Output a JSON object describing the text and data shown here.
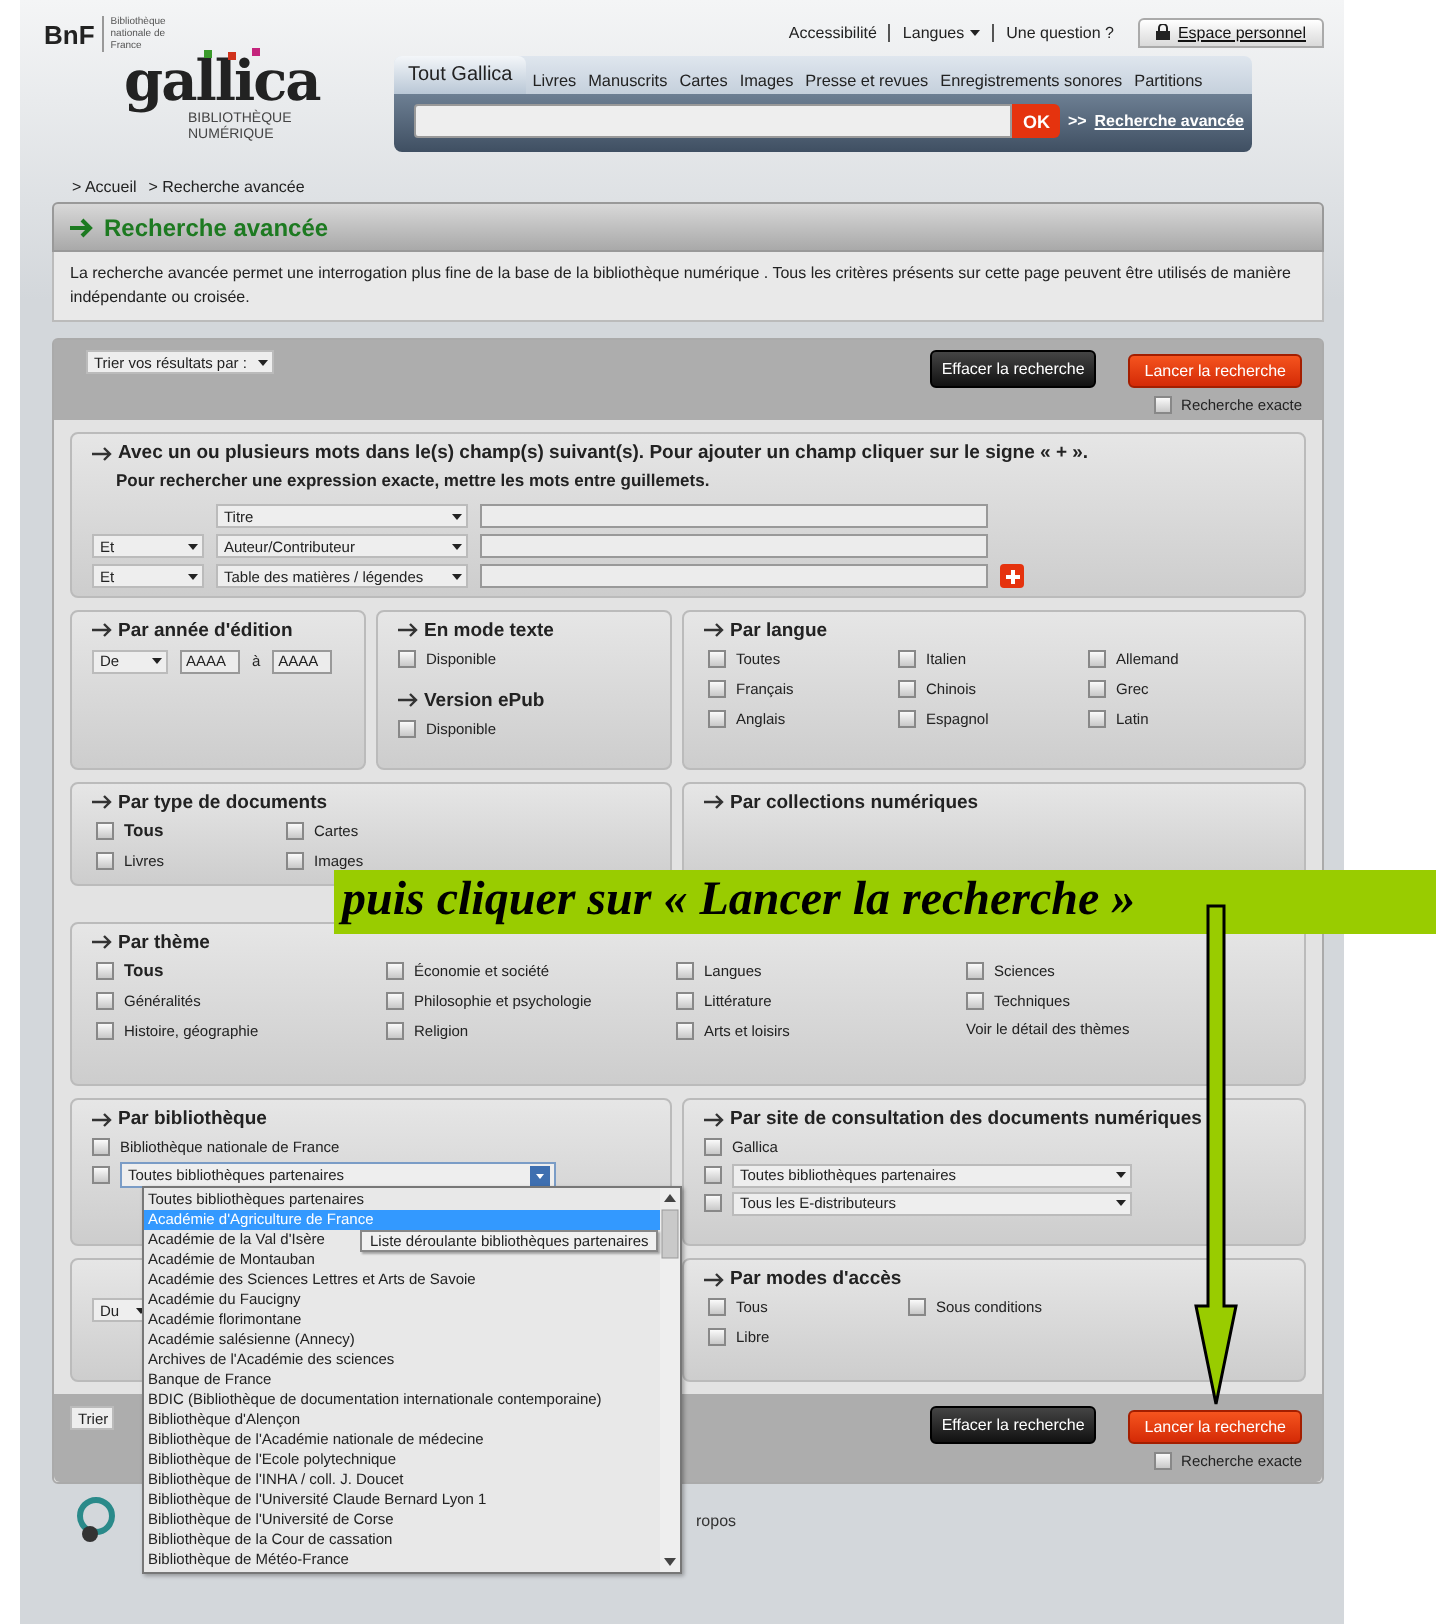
{
  "header": {
    "brand": "BnF",
    "brand_sub": "Bibliothèque nationale de France",
    "links": [
      {
        "label": "Accessibilité",
        "kind": "link"
      },
      {
        "label": "Langues",
        "kind": "menu"
      },
      {
        "label": "Une question ?",
        "kind": "link"
      }
    ],
    "account": "Espace personnel"
  },
  "logo": {
    "name": "gallica",
    "subtitle": "BIBLIOTHÈQUE NUMÉRIQUE"
  },
  "search": {
    "tabs": [
      {
        "label": "Tout Gallica",
        "selected": true
      },
      {
        "label": "Livres",
        "selected": false
      },
      {
        "label": "Manuscrits",
        "selected": false
      },
      {
        "label": "Cartes",
        "selected": false
      },
      {
        "label": "Images",
        "selected": false
      },
      {
        "label": "Presse et revues",
        "selected": false
      },
      {
        "label": "Enregistrements sonores",
        "selected": false
      },
      {
        "label": "Partitions",
        "selected": false
      }
    ],
    "button": "OK",
    "link_prefix": ">>",
    "link": "Recherche avancée"
  },
  "breadcrumb": [
    "> Accueil",
    "> Recherche avancée"
  ],
  "page_title": "Recherche avancée",
  "intro": "La recherche avancée permet une interrogation plus fine de la base de la bibliothèque numérique . Tous les critères présents sur cette page peuvent être utilisés de manière indépendante ou croisée.",
  "top_toolbar": {
    "sort": "Trier vos résultats par :",
    "clear": "Effacer la recherche",
    "launch": "Lancer la recherche",
    "exact": {
      "label": "Recherche exacte",
      "checked": false
    }
  },
  "words": {
    "instructions": [
      "Avec un ou plusieurs mots dans le(s) champ(s) suivant(s). Pour ajouter un champ cliquer sur le signe « + ».",
      "Pour rechercher une expression exacte, mettre les mots entre guillemets."
    ],
    "rows": [
      {
        "field": "Titre",
        "add": false
      },
      {
        "operator": "Et",
        "field": "Auteur/Contributeur",
        "add": false
      },
      {
        "operator": "Et",
        "field": "Table des matières / légendes",
        "add": true
      }
    ]
  },
  "year": {
    "title": "Par année d'édition",
    "mode": "De",
    "from": "AAAA",
    "separator": "à",
    "to": "AAAA"
  },
  "text_mode": {
    "title": "En mode texte",
    "option": {
      "label": "Disponible",
      "checked": false
    }
  },
  "epub": {
    "title": "Version ePub",
    "option": {
      "label": "Disponible",
      "checked": false
    }
  },
  "languages": {
    "title": "Par langue",
    "options": [
      {
        "label": "Toutes",
        "checked": false
      },
      {
        "label": "Italien",
        "checked": false
      },
      {
        "label": "Allemand",
        "checked": false
      },
      {
        "label": "Français",
        "checked": false
      },
      {
        "label": "Chinois",
        "checked": false
      },
      {
        "label": "Grec",
        "checked": false
      },
      {
        "label": "Anglais",
        "checked": false
      },
      {
        "label": "Espagnol",
        "checked": false
      },
      {
        "label": "Latin",
        "checked": false
      }
    ]
  },
  "doc_types": {
    "title": "Par type de documents",
    "options": [
      {
        "label": "Tous",
        "checked": false,
        "bold": true
      },
      {
        "label": "Cartes",
        "checked": false,
        "bold": false
      },
      {
        "label": "Livres",
        "checked": false,
        "bold": false
      },
      {
        "label": "Images",
        "checked": false,
        "bold": false
      }
    ]
  },
  "collections": {
    "title": "Par collections numériques"
  },
  "banner": "puis cliquer sur « Lancer la recherche »",
  "themes": {
    "title": "Par thème",
    "options": [
      {
        "label": "Tous",
        "checked": false,
        "bold": true
      },
      {
        "label": "Économie et société",
        "checked": false,
        "bold": false
      },
      {
        "label": "Langues",
        "checked": false,
        "bold": false
      },
      {
        "label": "Sciences",
        "checked": false,
        "bold": false
      },
      {
        "label": "Généralités",
        "checked": false,
        "bold": false
      },
      {
        "label": "Philosophie et psychologie",
        "checked": false,
        "bold": false
      },
      {
        "label": "Littérature",
        "checked": false,
        "bold": false
      },
      {
        "label": "Techniques",
        "checked": false,
        "bold": false
      },
      {
        "label": "Histoire, géographie",
        "checked": false,
        "bold": false
      },
      {
        "label": "Religion",
        "checked": false,
        "bold": false
      },
      {
        "label": "Arts et loisirs",
        "checked": false,
        "bold": false
      }
    ],
    "detail_link": "Voir le détail des thèmes"
  },
  "library": {
    "title": "Par bibliothèque",
    "option": {
      "label": "Bibliothèque nationale de France",
      "checked": false
    },
    "select": {
      "value": "Toutes bibliothèques partenaires",
      "checked": false,
      "expanded": true
    },
    "dropdown": {
      "tooltip": "Liste déroulante bibliothèques partenaires",
      "items": [
        {
          "label": "Toutes bibliothèques partenaires",
          "selected": false
        },
        {
          "label": "Académie d'Agriculture de France",
          "selected": true
        },
        {
          "label": "Académie de la Val d'Isère",
          "selected": false
        },
        {
          "label": "Académie de Montauban",
          "selected": false
        },
        {
          "label": "Académie des Sciences Lettres et Arts de Savoie",
          "selected": false
        },
        {
          "label": "Académie du Faucigny",
          "selected": false
        },
        {
          "label": "Académie florimontane",
          "selected": false
        },
        {
          "label": "Académie salésienne (Annecy)",
          "selected": false
        },
        {
          "label": "Archives de l'Académie des sciences",
          "selected": false
        },
        {
          "label": "Banque de France",
          "selected": false
        },
        {
          "label": "BDIC (Bibliothèque de documentation internationale contemporaine)",
          "selected": false
        },
        {
          "label": "Bibliothèque d'Alençon",
          "selected": false
        },
        {
          "label": "Bibliothèque de l'Académie nationale de médecine",
          "selected": false
        },
        {
          "label": "Bibliothèque de l'Ecole polytechnique",
          "selected": false
        },
        {
          "label": "Bibliothèque de l'INHA / coll. J. Doucet",
          "selected": false
        },
        {
          "label": "Bibliothèque de l'Université Claude Bernard Lyon 1",
          "selected": false
        },
        {
          "label": "Bibliothèque de l'Université de Corse",
          "selected": false
        },
        {
          "label": "Bibliothèque de la Cour de cassation",
          "selected": false
        },
        {
          "label": "Bibliothèque de Météo-France",
          "selected": false
        }
      ]
    }
  },
  "site": {
    "title": "Par site de consultation des documents numériques",
    "rows": [
      {
        "kind": "checkbox",
        "label": "Gallica",
        "checked": false
      },
      {
        "kind": "select",
        "value": "Toutes bibliothèques partenaires",
        "checked": false
      },
      {
        "kind": "select",
        "value": "Tous les E-distributeurs",
        "checked": false
      }
    ]
  },
  "date_panel": {
    "field": "Du"
  },
  "access": {
    "title": "Par modes d'accès",
    "options": [
      {
        "label": "Tous",
        "checked": false
      },
      {
        "label": "Sous conditions",
        "checked": false
      },
      {
        "label": "Libre",
        "checked": false
      }
    ]
  },
  "bottom_toolbar": {
    "sort": "Trier",
    "clear": "Effacer la recherche",
    "launch": "Lancer la recherche",
    "exact": {
      "label": "Recherche exacte",
      "checked": false
    }
  },
  "footer": {
    "text": "ropos"
  }
}
